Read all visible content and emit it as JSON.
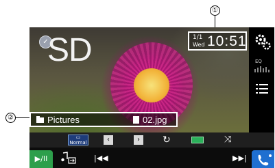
{
  "callouts": {
    "one": "①",
    "two": "②"
  },
  "screen": {
    "source_label": "SD",
    "clock": {
      "date": "1/1",
      "day": "Wed",
      "time": "10:51"
    },
    "right_menu": {
      "eq_label": "EQ"
    },
    "info_bar": {
      "folder": "Pictures",
      "file": "02.jpg"
    },
    "controls": {
      "normal_label": "Normal",
      "prev_folder_glyph": "‹",
      "next_folder_glyph": "›",
      "repeat_glyph": "↻",
      "shuffle_glyph": "⤨"
    },
    "bottom": {
      "play_pause": "▶/II",
      "prev": "|◀◀",
      "next": "▶▶|"
    }
  },
  "colors": {
    "accent_green": "#2d9f4b",
    "accent_blue": "#1f6fd0",
    "normal_btn": "#1e3c7a"
  },
  "icons": [
    "check-icon",
    "gear-icon",
    "eq-icon",
    "list-icon",
    "folder-icon",
    "file-icon",
    "repeat-icon",
    "shuffle-icon",
    "music-source-icon",
    "phone-icon"
  ]
}
